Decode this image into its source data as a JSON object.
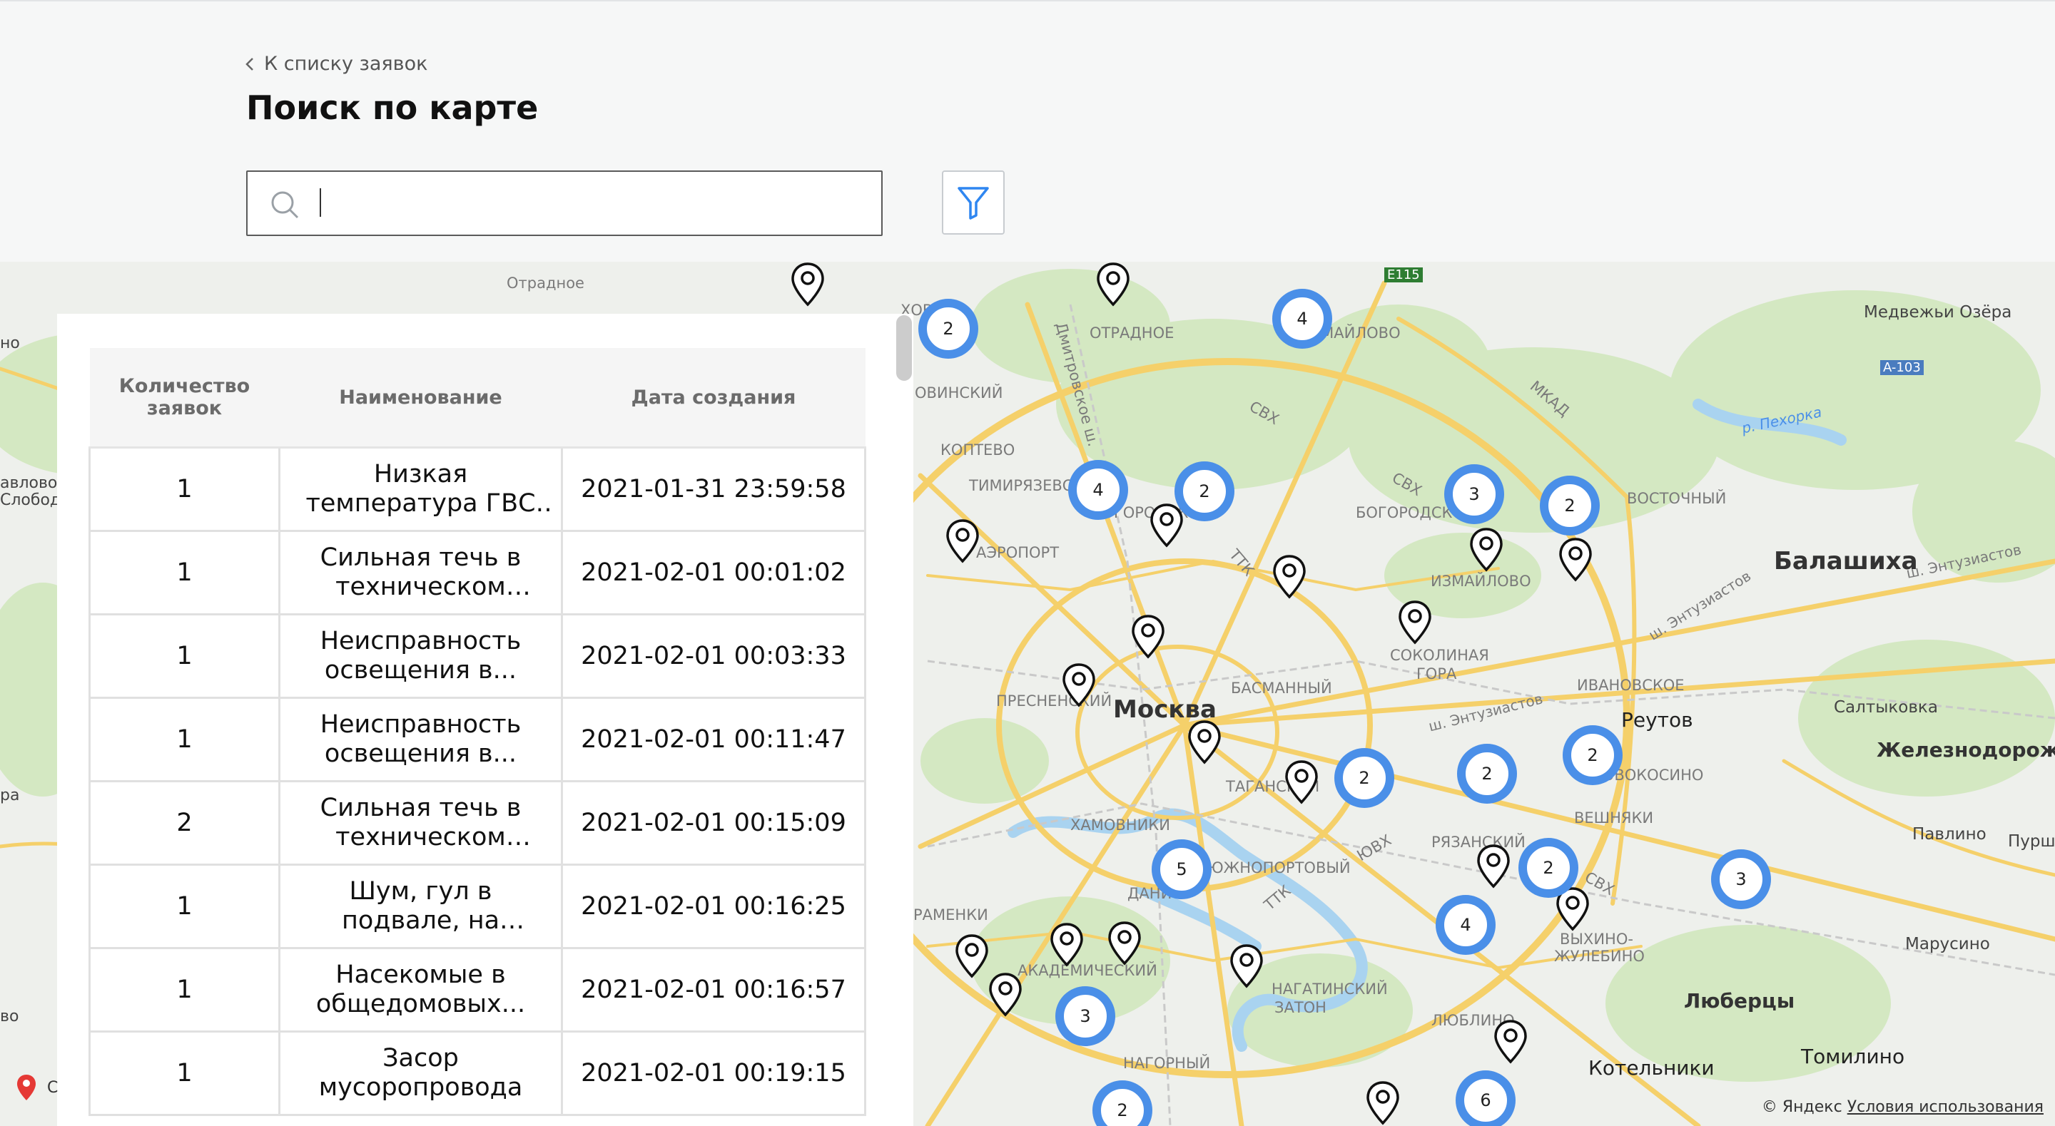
{
  "header": {
    "back_label": "К списку заявок",
    "title": "Поиск по карте",
    "search_placeholder": ""
  },
  "table": {
    "headers": [
      "Количество заявок",
      "Наименование",
      "Дата создания"
    ],
    "rows": [
      {
        "count": "1",
        "name": "Низкая температура ГВС (горячая вода)",
        "date": "2021-01-31 23:59:58"
      },
      {
        "count": "1",
        "name": "Сильная течь в техническом шкафу..",
        "date": "2021-02-01 00:01:02"
      },
      {
        "count": "1",
        "name": "Неисправность освещения в...",
        "date": "2021-02-01 00:03:33"
      },
      {
        "count": "1",
        "name": "Неисправность освещения в...",
        "date": "2021-02-01 00:11:47"
      },
      {
        "count": "2",
        "name": "Сильная течь в техническом шкафу..",
        "date": "2021-02-01 00:15:09"
      },
      {
        "count": "1",
        "name": "Шум, гул в подвале, на техническом...",
        "date": "2021-02-01 00:16:25"
      },
      {
        "count": "1",
        "name": "Насекомые в общедомовых...",
        "date": "2021-02-01 00:16:57"
      },
      {
        "count": "1",
        "name": "Засор мусоропровода",
        "date": "2021-02-01 00:19:15"
      }
    ]
  },
  "map": {
    "clusters": [
      "2",
      "4",
      "4",
      "2",
      "3",
      "2",
      "2",
      "2",
      "2",
      "5",
      "2",
      "4",
      "3",
      "3",
      "6",
      "2"
    ],
    "labels": {
      "otradnoe_small": "Отрадное",
      "otradnoe": "ОТРАДНОЕ",
      "medvezhi": "Медвежьи Озёра",
      "balashikha": "Балашиха",
      "moskva": "Москва",
      "reutov": "Реутов",
      "zheleznodorozhny": "Железнодорожный",
      "saltykovka": "Салтыковка",
      "pavlino": "Павлино",
      "purshe": "Пурше",
      "marusino": "Марусино",
      "lyubertsy": "Люберцы",
      "tomilino": "Томилино",
      "kotelniki": "Котельники",
      "izmaylovo": "ИЗМАЙЛОВО",
      "vostochny": "ВОСТОЧНЫЙ",
      "bogorodskoe": "БОГОРОДСКОЕ",
      "sokolinaya": "СОКОЛИНАЯ",
      "gora": "ГОРА",
      "basmanny": "БАСМАННЫЙ",
      "presnensky": "ПРЕСНЕНСКИЙ",
      "khamovniki": "ХАМОВНИКИ",
      "yuzhnoportovy": "ЮЖНОПОРТОВЫЙ",
      "nagatinsky": "НАГАТИНСКИЙ",
      "zaton": "ЗАТОН",
      "lyublino": "ЛЮБЛИНО",
      "nagorny": "НАГОРНЫЙ",
      "akademichesky": "АКАДЕМИЧЕСКИЙ",
      "ramenki": "РАМЕНКИ",
      "vykhino": "ВЫХИНО-",
      "zhulebino": "ЖУЛЕБИНО",
      "novokosino": "НОВОКОСИНО",
      "veshnyaki": "ВЕШНЯКИ",
      "ivanovskoe": "ИВАНОВСКОЕ",
      "ryazansky": "РЯЗАНСКИЙ",
      "koptevo": "КОПТЕВО",
      "timiryazevsky": "ТИМИРЯЗЕВСКИЙ",
      "aeroport": "АЭРОПОРТ",
      "khovrin": "ХОВРИН",
      "rp_pekhorka": "р. Пехорка",
      "sh_entuziastov": "ш. Энтузиастов",
      "mkad": "МКАД",
      "svkh": "СВХ",
      "ttk": "ТТК",
      "yuvkh": "ЮВХ",
      "e115": "E115",
      "a103": "A-103",
      "dmitrovskoe": "Дмитровское ш.",
      "tagansky": "ТАГАНСКИЙ",
      "dani": "ДАНИ",
      "no": "но",
      "avlovo": "авлово",
      "slobod": "Слобод",
      "ra": "ра",
      "vo": "во",
      "ovinsky": "ОВИНСКИЙ"
    },
    "geo_text": "С",
    "attribution": "© Яндекс",
    "terms_link": "Условия использования"
  },
  "colors": {
    "cluster": "#4a8fe8",
    "road": "#f5d06a",
    "park": "#d4e8c2",
    "water": "#a9d3f0"
  }
}
